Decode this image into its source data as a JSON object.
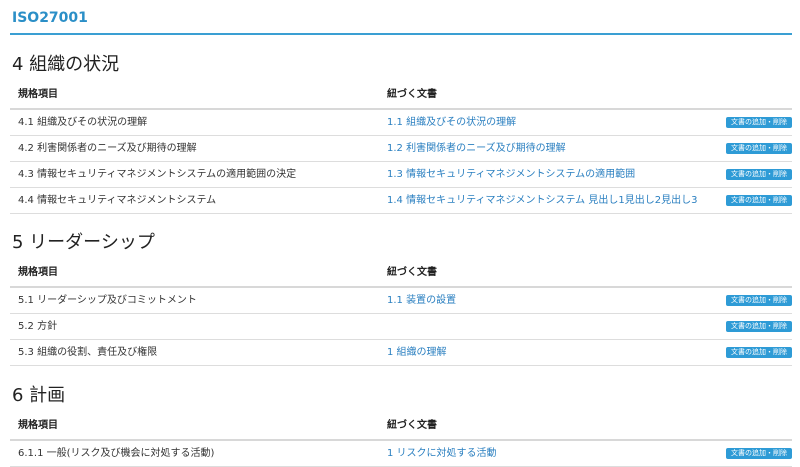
{
  "title": "ISO27001",
  "add_button_label": "文書の追加・削除",
  "accent_color": "#2e9bd6",
  "sections": [
    {
      "heading": "4 組織の状況",
      "col_item": "規格項目",
      "col_doc": "紐づく文書",
      "rows": [
        {
          "item": "4.1 組織及びその状況の理解",
          "doc": "1.1 組織及びその状況の理解"
        },
        {
          "item": "4.2 利害関係者のニーズ及び期待の理解",
          "doc": "1.2 利害関係者のニーズ及び期待の理解"
        },
        {
          "item": "4.3 情報セキュリティマネジメントシステムの適用範囲の決定",
          "doc": "1.3 情報セキュリティマネジメントシステムの適用範囲"
        },
        {
          "item": "4.4 情報セキュリティマネジメントシステム",
          "doc": "1.4 情報セキュリティマネジメントシステム 見出し1見出し2見出し3"
        }
      ]
    },
    {
      "heading": "5 リーダーシップ",
      "col_item": "規格項目",
      "col_doc": "紐づく文書",
      "rows": [
        {
          "item": "5.1 リーダーシップ及びコミットメント",
          "doc": "1.1 装置の設置"
        },
        {
          "item": "5.2 方針",
          "doc": ""
        },
        {
          "item": "5.3 組織の役割、責任及び権限",
          "doc": "1 組織の理解"
        }
      ]
    },
    {
      "heading": "6 計画",
      "col_item": "規格項目",
      "col_doc": "紐づく文書",
      "rows": [
        {
          "item": "6.1.1 一般(リスク及び機会に対処する活動)",
          "doc": "1 リスクに対処する活動"
        }
      ]
    }
  ]
}
